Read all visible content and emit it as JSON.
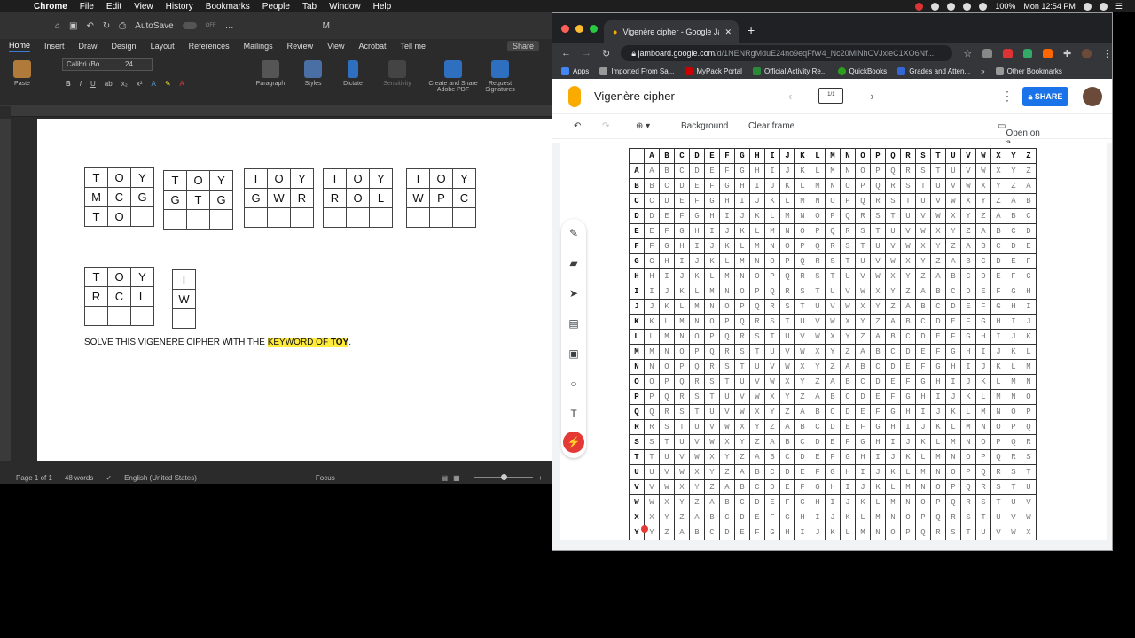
{
  "menubar": {
    "app": "Chrome",
    "items": [
      "File",
      "Edit",
      "View",
      "History",
      "Bookmarks",
      "People",
      "Tab",
      "Window",
      "Help"
    ],
    "battery": "100%",
    "clock": "Mon 12:54 PM"
  },
  "word": {
    "autosave_label": "AutoSave",
    "autosave_state": "OFF",
    "title": "M",
    "tabs": [
      "Home",
      "Insert",
      "Draw",
      "Design",
      "Layout",
      "References",
      "Mailings",
      "Review",
      "View",
      "Acrobat"
    ],
    "tell_me": "Tell me",
    "share": "Share",
    "comments": "Comments",
    "font_name": "Calibri (Bo...",
    "font_size": "24",
    "ribbon": {
      "paste": "Paste",
      "paragraph": "Paragraph",
      "styles": "Styles",
      "dictate": "Dictate",
      "sensitivity": "Sensitivity",
      "create_pdf": "Create and Share Adobe PDF",
      "request_signatures": "Request Signatures"
    },
    "grids": [
      {
        "rows": [
          [
            "T",
            "O",
            "Y"
          ],
          [
            "M",
            "C",
            "G"
          ],
          [
            "T",
            "O",
            ""
          ]
        ]
      },
      {
        "rows": [
          [
            "T",
            "O",
            "Y"
          ],
          [
            "G",
            "T",
            "G"
          ],
          [
            "",
            "",
            ""
          ]
        ]
      },
      {
        "rows": [
          [
            "T",
            "O",
            "Y"
          ],
          [
            "G",
            "W",
            "R"
          ],
          [
            "",
            "",
            ""
          ]
        ]
      },
      {
        "rows": [
          [
            "T",
            "O",
            "Y"
          ],
          [
            "R",
            "O",
            "L"
          ],
          [
            "",
            "",
            ""
          ]
        ]
      },
      {
        "rows": [
          [
            "T",
            "O",
            "Y"
          ],
          [
            "W",
            "P",
            "C"
          ],
          [
            "",
            "",
            ""
          ]
        ]
      },
      {
        "rows": [
          [
            "T",
            "O",
            "Y"
          ],
          [
            "R",
            "C",
            "L"
          ],
          [
            "",
            "",
            ""
          ]
        ]
      },
      {
        "rows": [
          [
            "T"
          ],
          [
            "W"
          ],
          [
            ""
          ]
        ]
      }
    ],
    "instruction_prefix": "SOLVE THIS VIGENERE CIPHER WITH THE ",
    "instruction_highlight": "KEYWORD OF ",
    "instruction_keyword": "TOY",
    "instruction_suffix": ".",
    "status": {
      "page": "Page 1 of 1",
      "words": "48 words",
      "language": "English (United States)",
      "focus": "Focus"
    }
  },
  "chrome": {
    "tab_title": "Vigenère cipher - Google Jamboard",
    "url_host": "jamboard.google.com",
    "url_path": "/d/1NENRgMduE24no9eqFfW4_Nc20MiNhCVJxieC1XO6Nf...",
    "bookmarks": [
      "Apps",
      "Imported From Sa...",
      "MyPack Portal",
      "Official Activity Re...",
      "QuickBooks",
      "Grades and Atten..."
    ],
    "other_bookmarks": "Other Bookmarks"
  },
  "jamboard": {
    "title": "Vigenère cipher",
    "frame_counter": "1/1",
    "share": "SHARE",
    "toolbar": {
      "background": "Background",
      "clear_frame": "Clear frame",
      "open_on_jamboard": "Open on a Jamboard"
    },
    "tools": [
      "pen-icon",
      "eraser-icon",
      "select-icon",
      "sticky-note-icon",
      "image-icon",
      "circle-icon",
      "text-box-icon",
      "laser-icon"
    ],
    "alphabet": "ABCDEFGHIJKLMNOPQRSTUVWXYZ",
    "visible_rows": 25
  },
  "colors": {
    "word_bg": "#2b2b2b",
    "chrome_dark": "#35363a",
    "share_blue": "#1a73e8",
    "highlight": "#ffeb3b",
    "laser_red": "#e53935"
  }
}
